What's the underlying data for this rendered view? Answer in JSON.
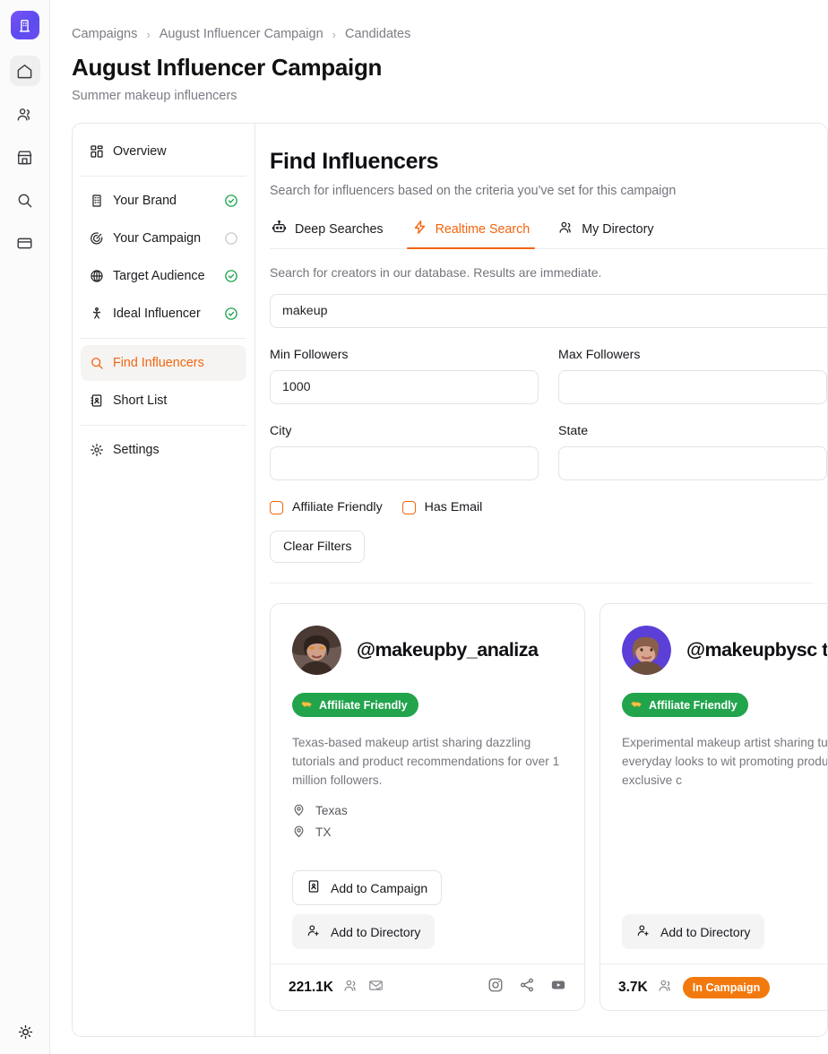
{
  "rail": {
    "logo_icon": "building-logo-icon",
    "items": [
      {
        "icon": "home-icon",
        "name": "rail-item-home",
        "active": true
      },
      {
        "icon": "users-icon",
        "name": "rail-item-people",
        "active": false
      },
      {
        "icon": "store-icon",
        "name": "rail-item-brands",
        "active": false
      },
      {
        "icon": "search-icon",
        "name": "rail-item-search",
        "active": false
      },
      {
        "icon": "card-icon",
        "name": "rail-item-billing",
        "active": false
      }
    ],
    "theme_toggle_icon": "sun-icon"
  },
  "breadcrumb": {
    "items": [
      "Campaigns",
      "August Influencer Campaign",
      "Candidates"
    ],
    "separator": "›"
  },
  "header": {
    "title": "August Influencer Campaign",
    "subtitle": "Summer makeup influencers"
  },
  "section_nav": {
    "items": [
      {
        "label": "Overview",
        "icon": "grid-icon",
        "status": "none",
        "active": false
      },
      {
        "label": "Your Brand",
        "icon": "building-icon",
        "status": "complete",
        "active": false
      },
      {
        "label": "Your Campaign",
        "icon": "target-icon",
        "status": "incomplete",
        "active": false
      },
      {
        "label": "Target Audience",
        "icon": "globe-icon",
        "status": "complete",
        "active": false
      },
      {
        "label": "Ideal Influencer",
        "icon": "person-icon",
        "status": "complete",
        "active": false
      },
      {
        "label": "Find Influencers",
        "icon": "search-icon",
        "status": "none",
        "active": true
      },
      {
        "label": "Short List",
        "icon": "contact-book-icon",
        "status": "none",
        "active": false
      },
      {
        "label": "Settings",
        "icon": "gear-icon",
        "status": "none",
        "active": false
      }
    ]
  },
  "main": {
    "title": "Find Influencers",
    "subtitle": "Search for influencers based on the criteria you've set for this campaign",
    "tabs": [
      {
        "label": "Deep Searches",
        "icon": "robot-icon",
        "active": false
      },
      {
        "label": "Realtime Search",
        "icon": "lightning-icon",
        "active": true
      },
      {
        "label": "My Directory",
        "icon": "users-icon",
        "active": false
      }
    ],
    "tab_hint": "Search for creators in our database. Results are immediate.",
    "search": {
      "value": "makeup",
      "placeholder": "Search"
    },
    "filters": {
      "min_followers": {
        "label": "Min Followers",
        "value": "1000",
        "placeholder": ""
      },
      "max_followers": {
        "label": "Max Followers",
        "value": "",
        "placeholder": ""
      },
      "city": {
        "label": "City",
        "value": "",
        "placeholder": ""
      },
      "state": {
        "label": "State",
        "value": "",
        "placeholder": ""
      },
      "affiliate_friendly": {
        "label": "Affiliate Friendly",
        "checked": false
      },
      "has_email": {
        "label": "Has Email",
        "checked": false
      },
      "clear_label": "Clear Filters"
    }
  },
  "results": [
    {
      "handle": "@makeupby_analiza",
      "badge": "Affiliate Friendly",
      "badge_icon": "handshake-icon",
      "description": "Texas-based makeup artist sharing dazzling tutorials and product recommendations for over 1 million followers.",
      "locations": [
        "Texas",
        "TX"
      ],
      "actions": [
        {
          "label": "Add to Campaign",
          "icon": "contact-book-icon",
          "style": "outline"
        },
        {
          "label": "Add to Directory",
          "icon": "user-plus-icon",
          "style": "filled"
        }
      ],
      "followers": "221.1K",
      "foot_icons": [
        "users-icon",
        "mail-check-icon"
      ],
      "social_icons": [
        "instagram-icon",
        "share-icon",
        "youtube-icon"
      ],
      "in_campaign": false,
      "avatar_colors": [
        "#6d5a52",
        "#c79a84",
        "#3a2b25"
      ]
    },
    {
      "handle": "@makeupbysc t",
      "badge": "Affiliate Friendly",
      "badge_icon": "handshake-icon",
      "description": "Experimental makeup artist sharing tutorials from everyday looks to wit promoting products with exclusive c",
      "locations": [],
      "actions": [
        {
          "label": "Add to Directory",
          "icon": "user-plus-icon",
          "style": "filled"
        }
      ],
      "followers": "3.7K",
      "foot_icons": [
        "users-icon"
      ],
      "social_icons": [
        "share-icon"
      ],
      "in_campaign": true,
      "in_campaign_label": "In Campaign",
      "avatar_colors": [
        "#5b3fd6",
        "#d9a58f",
        "#8a5f4a"
      ]
    }
  ],
  "colors": {
    "accent": "#f2650e",
    "accent_alt": "#f2790e",
    "success": "#22a44d",
    "logo": "#6d4bf2"
  }
}
